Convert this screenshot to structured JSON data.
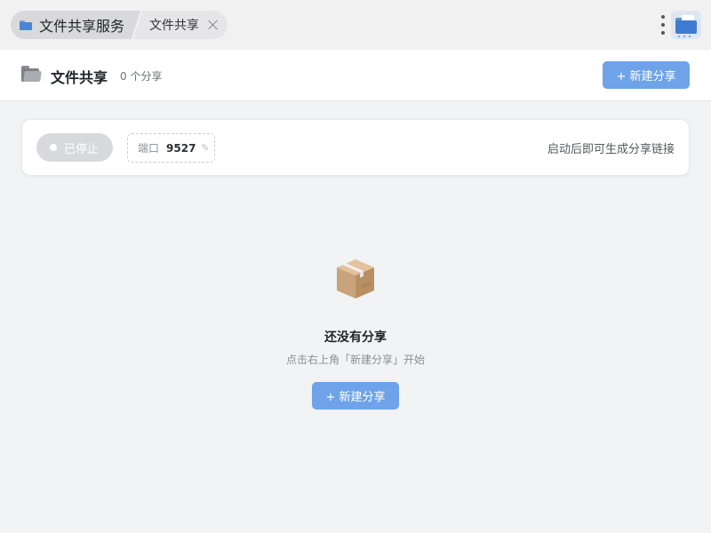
{
  "titlebar": {
    "app_title": "文件共享服务",
    "tab_label": "文件共享"
  },
  "header": {
    "title": "文件共享",
    "share_count": "0 个分享",
    "new_share_label": "+ 新建分享"
  },
  "status_card": {
    "status_label": "已停止",
    "port_label": "端口",
    "port_value": "9527",
    "edit_glyph": "✎",
    "hint": "启动后即可生成分享链接"
  },
  "empty_state": {
    "title": "还没有分享",
    "subtitle": "点击右上角「新建分享」开始",
    "button_label": "+ 新建分享"
  },
  "icons": {
    "titlebar": "folder-icon",
    "menu": "kebab-menu-icon",
    "app": "file-share-app-icon",
    "header": "folder-icon",
    "empty": "package-box-icon",
    "close": "close-icon",
    "edit": "pencil-icon"
  },
  "colors": {
    "accent": "#6ea3ea",
    "status_stopped": "#d8d9dc",
    "background": "#f2f3f5"
  }
}
